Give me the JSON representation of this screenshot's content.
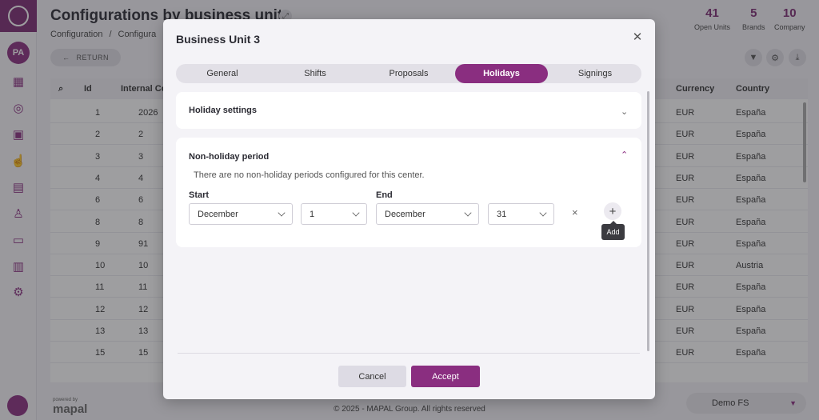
{
  "app": {
    "page_title": "Configurations by business unit",
    "breadcrumb": [
      "Configuration",
      "Configura"
    ],
    "avatar_initials": "PA",
    "stats": [
      {
        "value": "41",
        "label": "Open Units"
      },
      {
        "value": "5",
        "label": "Brands"
      },
      {
        "value": "10",
        "label": "Company"
      }
    ],
    "return_label": "RETURN",
    "table": {
      "headers": {
        "id": "Id",
        "internal": "Internal Co",
        "currency": "Currency",
        "country": "Country"
      },
      "rows": [
        {
          "id": "1",
          "code": "2026",
          "currency": "EUR",
          "country": "España"
        },
        {
          "id": "2",
          "code": "2",
          "currency": "EUR",
          "country": "España"
        },
        {
          "id": "3",
          "code": "3",
          "currency": "EUR",
          "country": "España"
        },
        {
          "id": "4",
          "code": "4",
          "currency": "EUR",
          "country": "España"
        },
        {
          "id": "6",
          "code": "6",
          "currency": "EUR",
          "country": "España"
        },
        {
          "id": "8",
          "code": "8",
          "currency": "EUR",
          "country": "España"
        },
        {
          "id": "9",
          "code": "91",
          "currency": "EUR",
          "country": "España"
        },
        {
          "id": "10",
          "code": "10",
          "currency": "EUR",
          "country": "Austria"
        },
        {
          "id": "11",
          "code": "11",
          "currency": "EUR",
          "country": "España"
        },
        {
          "id": "12",
          "code": "12",
          "currency": "EUR",
          "country": "España"
        },
        {
          "id": "13",
          "code": "13",
          "currency": "EUR",
          "country": "España"
        },
        {
          "id": "15",
          "code": "15",
          "currency": "EUR",
          "country": "España"
        }
      ]
    },
    "footer": {
      "brand": "mapal",
      "powered_by": "powered by",
      "copyright": "© 2025 - MAPAL Group. All rights reserved",
      "workspace": "Demo FS"
    }
  },
  "modal": {
    "title": "Business Unit 3",
    "tabs": [
      {
        "label": "General",
        "active": false
      },
      {
        "label": "Shifts",
        "active": false
      },
      {
        "label": "Proposals",
        "active": false
      },
      {
        "label": "Holidays",
        "active": true
      },
      {
        "label": "Signings",
        "active": false
      }
    ],
    "holiday_settings": {
      "title": "Holiday settings",
      "expanded": false
    },
    "non_holiday": {
      "title": "Non-holiday period",
      "expanded": true,
      "empty_message": "There are no non-holiday periods configured for this center.",
      "start_label": "Start",
      "end_label": "End",
      "start_month": "December",
      "start_day": "1",
      "end_month": "December",
      "end_day": "31",
      "add_tooltip": "Add"
    },
    "cancel_label": "Cancel",
    "accept_label": "Accept"
  },
  "colors": {
    "accent": "#8a2e80",
    "brand": "#7d2b74"
  }
}
